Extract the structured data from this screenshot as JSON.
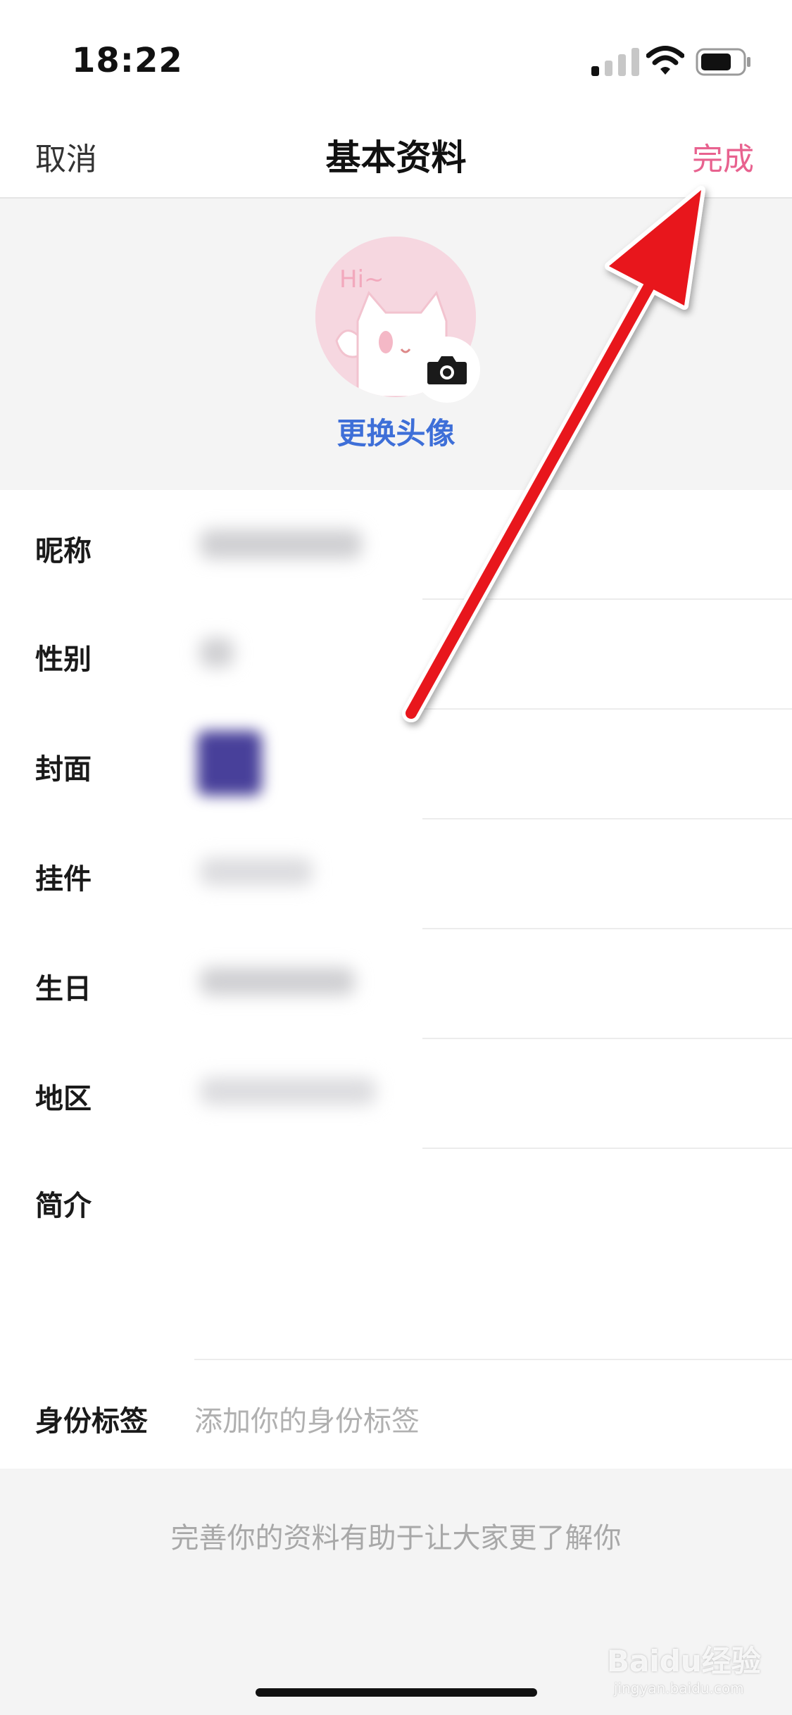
{
  "status_bar": {
    "time": "18:22"
  },
  "nav": {
    "cancel": "取消",
    "title": "基本资料",
    "done": "完成"
  },
  "avatar": {
    "change_label": "更换头像",
    "art_text": "Hi~"
  },
  "form": {
    "rows": [
      {
        "label": "昵称"
      },
      {
        "label": "性别"
      },
      {
        "label": "封面"
      },
      {
        "label": "挂件"
      },
      {
        "label": "生日"
      },
      {
        "label": "地区"
      },
      {
        "label": "简介"
      },
      {
        "label": "身份标签",
        "placeholder": "添加你的身份标签"
      }
    ]
  },
  "footer": {
    "hint": "完善你的资料有助于让大家更了解你"
  },
  "watermark": {
    "brand": "Baidu经验",
    "url": "jingyan.baidu.com"
  },
  "colors": {
    "accent": "#e8628f",
    "link": "#3e6fd8",
    "annotation_arrow": "#e8141b"
  }
}
